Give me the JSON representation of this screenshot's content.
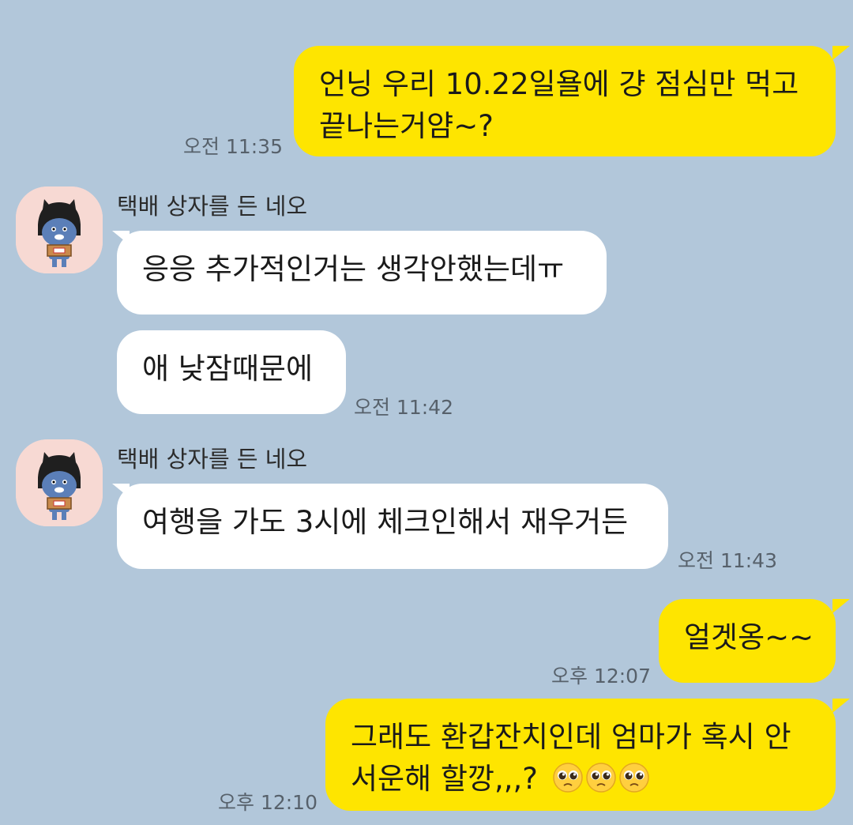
{
  "chat": {
    "background_color": "#b2c7da",
    "my_bubble_color": "#fee500",
    "other_bubble_color": "#ffffff",
    "messages": [
      {
        "lines": [
          "언닝 우리 10.22일욜에 걍 점심만 먹고",
          "끝나는거얌~?"
        ],
        "time": "오전 11:35"
      },
      {
        "sender": "택배 상자를 든 네오",
        "text": "응응 추가적인거는 생각안했는데ㅠ"
      },
      {
        "text": "애 낮잠때문에",
        "time": "오전 11:42"
      },
      {
        "sender": "택배 상자를 든 네오",
        "text": "여행을 가도 3시에 체크인해서 재우거든",
        "time": "오전 11:43"
      },
      {
        "text": "얼겟옹~~",
        "time": "오후 12:07"
      },
      {
        "lines": [
          "그래도 환갑잔치인데 엄마가 혹시 안",
          "서운해 할깡,,,? "
        ],
        "emojis": [
          "pleading-face-emoji",
          "pleading-face-emoji",
          "pleading-face-emoji"
        ],
        "time": "오후 12:10"
      }
    ]
  }
}
